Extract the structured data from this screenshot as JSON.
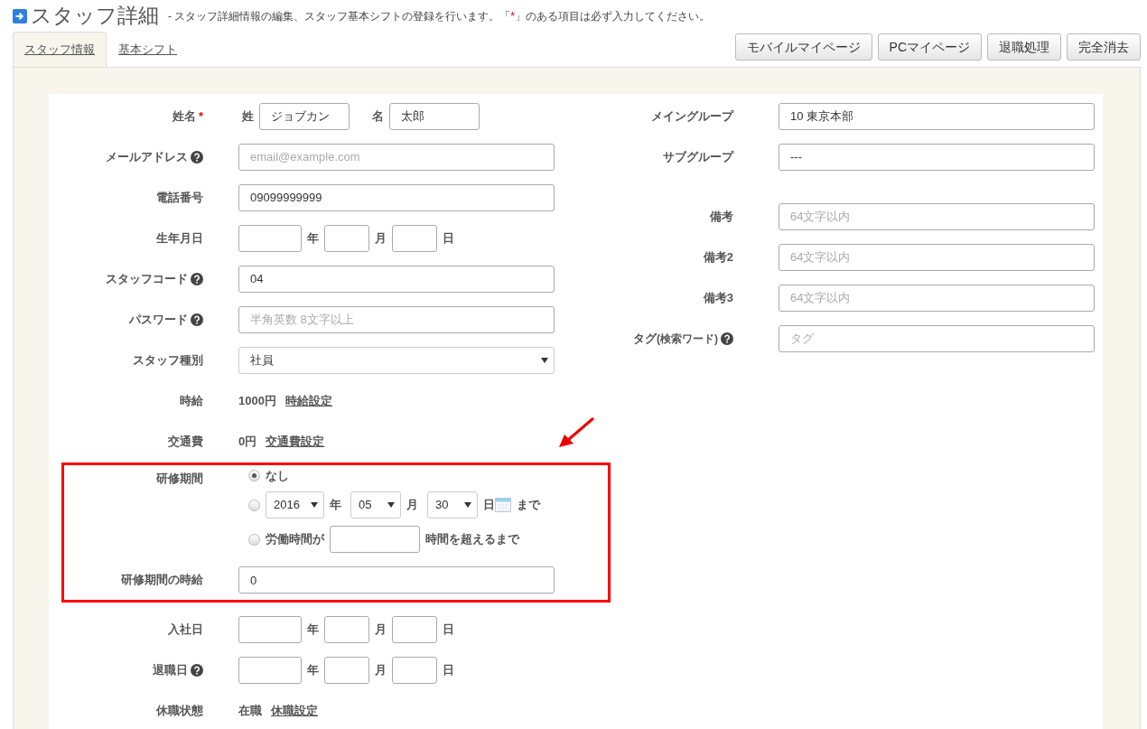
{
  "header": {
    "title": "スタッフ詳細",
    "description": "- スタッフ詳細情報の編集、スタッフ基本シフトの登録を行います。「",
    "required_mark": "*",
    "description_end": "」のある項目は必ず入力してください。"
  },
  "tabs": [
    {
      "label": "スタッフ情報",
      "selected": true
    },
    {
      "label": "基本シフト",
      "selected": false
    }
  ],
  "actions": [
    "モバイルマイページ",
    "PCマイページ",
    "退職処理",
    "完全消去"
  ],
  "left_sections": [
    {
      "highlighted": false,
      "rows": [
        {
          "kind": "name",
          "label": "姓名",
          "required": true,
          "help": false,
          "parts": [
            {
              "label": "姓",
              "value": "ジョブカン"
            },
            {
              "label": "名",
              "value": "太郎"
            }
          ]
        },
        {
          "kind": "input",
          "label": "メールアドレス",
          "required": false,
          "help": true,
          "placeholder": "email@example.com"
        },
        {
          "kind": "input",
          "label": "電話番号",
          "required": false,
          "help": false,
          "value": "09099999999"
        },
        {
          "kind": "date",
          "label": "生年月日",
          "required": false,
          "help": false,
          "units": [
            "年",
            "月",
            "日"
          ]
        },
        {
          "kind": "input",
          "label": "スタッフコード",
          "required": false,
          "help": true,
          "value": "04"
        },
        {
          "kind": "input",
          "label": "パスワード",
          "required": false,
          "help": true,
          "placeholder": "半角英数 8文字以上"
        },
        {
          "kind": "select",
          "label": "スタッフ種別",
          "required": false,
          "help": false,
          "value": "社員"
        },
        {
          "kind": "amount",
          "label": "時給",
          "required": false,
          "help": false,
          "amount": "1000円",
          "link": "時給設定"
        },
        {
          "kind": "amount",
          "label": "交通費",
          "required": false,
          "help": false,
          "amount": "0円",
          "link": "交通費設定"
        }
      ]
    },
    {
      "highlighted": true,
      "rows": [
        {
          "kind": "training",
          "label": "研修期間",
          "required": false,
          "help": false,
          "options": [
            {
              "kind": "plain",
              "label": "なし",
              "selected": true
            },
            {
              "kind": "date",
              "selected": false,
              "year": "2016",
              "month": "05",
              "day": "30",
              "units": [
                "年",
                "月",
                "日"
              ],
              "suffix": "まで"
            },
            {
              "kind": "hours",
              "selected": false,
              "prefix": "労働時間が",
              "suffix": "時間を超えるまで"
            }
          ]
        },
        {
          "kind": "input",
          "label": "研修期間の時給",
          "required": false,
          "help": false,
          "value": "0"
        }
      ]
    },
    {
      "highlighted": false,
      "rows": [
        {
          "kind": "date",
          "label": "入社日",
          "required": false,
          "help": false,
          "units": [
            "年",
            "月",
            "日"
          ]
        },
        {
          "kind": "date",
          "label": "退職日",
          "required": false,
          "help": true,
          "units": [
            "年",
            "月",
            "日"
          ]
        },
        {
          "kind": "amount",
          "label": "休職状態",
          "required": false,
          "help": false,
          "amount": "在職",
          "link": "休職設定"
        }
      ]
    }
  ],
  "right_groups": [
    [
      {
        "label": "メイングループ",
        "help": false,
        "value": "10 東京本部"
      },
      {
        "label": "サブグループ",
        "help": false,
        "value": "---"
      }
    ],
    [
      {
        "label": "備考",
        "help": false,
        "placeholder": "64文字以内"
      },
      {
        "label": "備考2",
        "help": false,
        "placeholder": "64文字以内"
      },
      {
        "label": "備考3",
        "help": false,
        "placeholder": "64文字以内"
      },
      {
        "label": "タグ",
        "label_note": "(検索ワード)",
        "help": true,
        "placeholder": "タグ"
      }
    ]
  ]
}
